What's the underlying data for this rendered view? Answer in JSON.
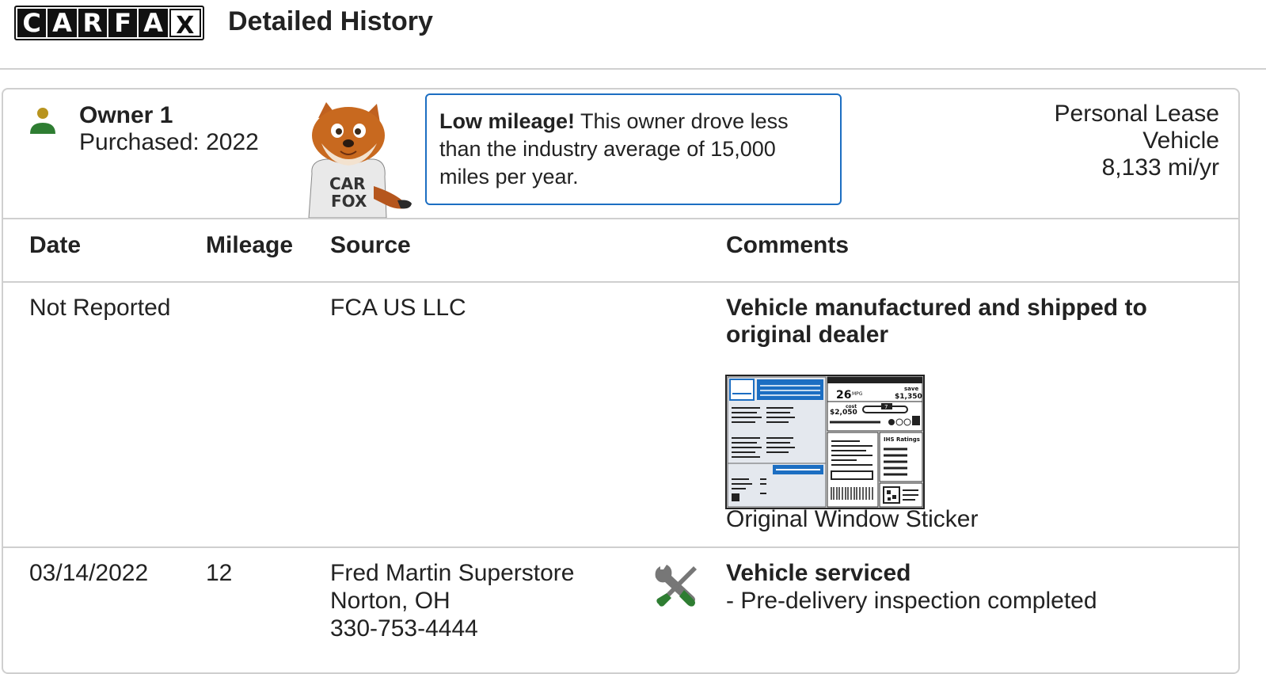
{
  "header": {
    "logo_letters": [
      "C",
      "A",
      "R",
      "F",
      "A",
      "X"
    ],
    "title": "Detailed History"
  },
  "owner": {
    "title": "Owner 1",
    "purchased": "Purchased: 2022",
    "callout_bold": "Low mileage!",
    "callout_text": " This owner drove less than the industry average of 15,000 miles per year.",
    "lease_line1": "Personal Lease",
    "lease_line2": "Vehicle",
    "mileage_rate": "8,133 mi/yr",
    "fox_shirt_text": [
      "CAR",
      "FOX"
    ]
  },
  "table": {
    "headers": {
      "date": "Date",
      "mileage": "Mileage",
      "source": "Source",
      "comments": "Comments"
    },
    "rows": [
      {
        "date": "Not Reported",
        "mileage": "",
        "source": [
          "FCA US LLC"
        ],
        "comment_title": "Vehicle manufactured and shipped to original dealer",
        "comment_detail": "",
        "link": "Original Window Sticker",
        "icon": "window-sticker-icon"
      },
      {
        "date": "03/14/2022",
        "mileage": "12",
        "source": [
          "Fred Martin Superstore",
          "Norton, OH",
          "330-753-4444"
        ],
        "comment_title": "Vehicle serviced",
        "comment_detail": "- Pre-delivery inspection completed",
        "icon": "wrench-screwdriver-icon"
      }
    ]
  },
  "sticker": {
    "mpg": "26",
    "mpg_unit": "MPG",
    "you_save_label": "save",
    "you_save": "$1,350",
    "fuel_cost_label": "cost",
    "fuel_cost": "$2,050",
    "rating": "7",
    "ratings_label": "IHS Ratings"
  },
  "colors": {
    "accent_blue": "#1c6ec2",
    "person_head": "#b8941f",
    "person_body": "#2e7d32",
    "tool_green": "#2e7d32",
    "tool_gray": "#777777",
    "border": "#cfcfcf"
  }
}
